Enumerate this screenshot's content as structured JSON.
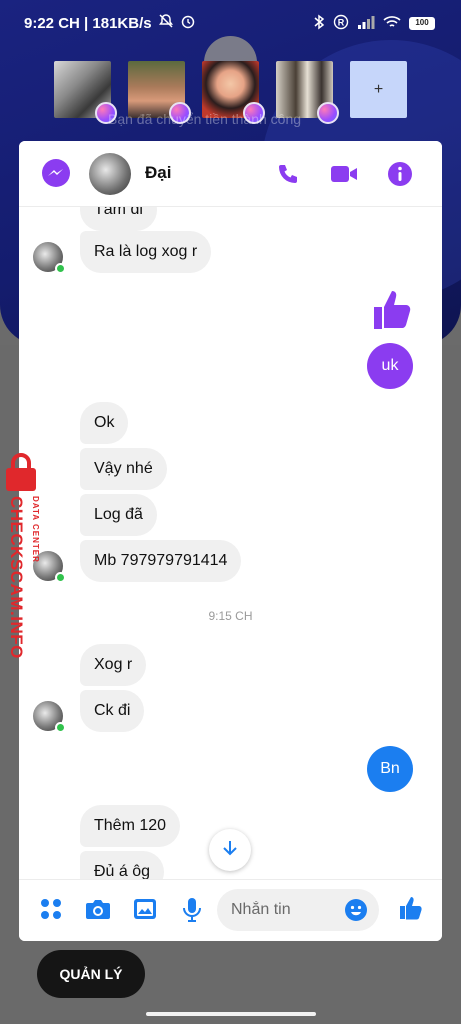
{
  "status_bar": {
    "time_speed": "9:22 CH | 181KB/s",
    "battery": "100"
  },
  "heads": [
    {
      "name": "head-car"
    },
    {
      "name": "head-group"
    },
    {
      "name": "head-girl"
    },
    {
      "name": "head-people"
    }
  ],
  "heads_plus": "+",
  "notice": "Bạn đã chuyển tiền thành công",
  "header": {
    "contact_name": "Đại"
  },
  "messages": [
    {
      "text": "Tám đi",
      "dir": "in"
    },
    {
      "text": "Ra là log xog r",
      "dir": "in"
    },
    {
      "text": "uk",
      "dir": "out"
    },
    {
      "text": "Ok",
      "dir": "in"
    },
    {
      "text": "Vậy nhé",
      "dir": "in"
    },
    {
      "text": "Log đã",
      "dir": "in"
    },
    {
      "text": "Mb 797979791414",
      "dir": "in"
    },
    {
      "text": "Xog r",
      "dir": "in"
    },
    {
      "text": "Ck đi",
      "dir": "in"
    },
    {
      "text": "Bn",
      "dir": "out"
    },
    {
      "text": "Thêm 120",
      "dir": "in"
    },
    {
      "text": "Đủ á ôg",
      "dir": "in"
    }
  ],
  "timestamp": "9:15 CH",
  "composer": {
    "placeholder": "Nhắn tin"
  },
  "manage_button": "QUẢN LÝ",
  "watermark": {
    "main": "CHECKSCAM.INFO",
    "sub": "DATA CENTER"
  },
  "colors": {
    "accent_purple": "#8b3cf0",
    "bubble_blue": "#1b7ef0",
    "online_green": "#31c24d",
    "watermark_red": "#e0282c"
  }
}
